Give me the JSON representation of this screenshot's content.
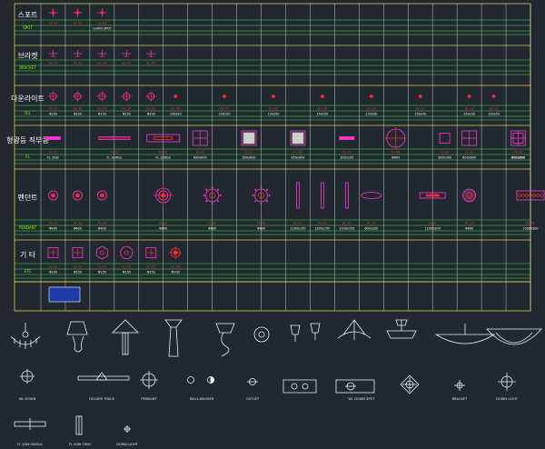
{
  "colors": {
    "background": "#212830",
    "frame": "#d8cc52",
    "grid_green": "#3ee84a",
    "grid_white": "#e8eef4",
    "magenta": "#ff36d0",
    "red": "#ff2b2b",
    "blue_fill": "#1c3aa8"
  },
  "legend_rows": [
    {
      "name": "spot",
      "category_label": "스포트",
      "code_label": "SPOT",
      "items": [
        {
          "icon": "crosshair-icon",
          "code": "SL-01",
          "desc": ""
        },
        {
          "icon": "crosshair-icon",
          "code": "SL-02",
          "desc": ""
        },
        {
          "icon": "crosshair-icon",
          "code": "SL-03",
          "desc": "CHAIN SPOT"
        }
      ]
    },
    {
      "name": "bracket",
      "category_label": "브라켓",
      "code_label": "BRACKET",
      "items": [
        {
          "icon": "bracket-icon",
          "code": "BL-01",
          "desc": ""
        },
        {
          "icon": "bracket-icon",
          "code": "BL-02",
          "desc": ""
        },
        {
          "icon": "bracket-icon",
          "code": "BL-03",
          "desc": ""
        },
        {
          "icon": "bracket-icon",
          "code": "BL-04",
          "desc": ""
        },
        {
          "icon": "bracket-icon",
          "code": "BL-05",
          "desc": ""
        }
      ]
    },
    {
      "name": "downlight",
      "category_label": "다운라이트",
      "code_label": "D/L",
      "items": [
        {
          "icon": "ring-cross-icon",
          "code": "DL-01",
          "desc": "Φ100"
        },
        {
          "icon": "ring-cross-icon",
          "code": "DL-02",
          "desc": "Φ150"
        },
        {
          "icon": "ring-cross-icon",
          "code": "DL-03",
          "desc": "Φ150"
        },
        {
          "icon": "ring-cross-icon",
          "code": "DL-04",
          "desc": "Φ150"
        },
        {
          "icon": "ring-cross-icon",
          "code": "DL-05",
          "desc": "Φ100"
        },
        {
          "icon": "dot-icon",
          "code": "DL-06",
          "desc": "150x50"
        },
        {
          "icon": "dot-icon",
          "code": "DL-07",
          "desc": "150x50"
        },
        {
          "icon": "dot-icon",
          "code": "DL-08",
          "desc": "150x50"
        },
        {
          "icon": "dot-icon",
          "code": "DL-09",
          "desc": "150x50"
        },
        {
          "icon": "dot-icon",
          "code": "DL-10",
          "desc": "150x50"
        },
        {
          "icon": "dot-icon",
          "code": "DL-11",
          "desc": "150x50"
        },
        {
          "icon": "dot-icon",
          "code": "DL-12",
          "desc": "150x50"
        },
        {
          "icon": "dot-icon",
          "code": "DL-13",
          "desc": "150x50"
        }
      ]
    },
    {
      "name": "fluorescent",
      "category_label": "형광등 직부등",
      "code_label": "FL",
      "items": [
        {
          "icon": "tube-icon",
          "code": "FL-01",
          "desc": "FL 32W"
        },
        {
          "icon": "tube-long-icon",
          "code": "FL-02",
          "desc": "FL 32Wx2"
        },
        {
          "icon": "tube-box-icon",
          "code": "FL-03",
          "desc": "FL 32Wx2"
        },
        {
          "icon": "square-grid-icon",
          "code": "FL-04",
          "desc": "600x600"
        },
        {
          "icon": "square-solid-icon",
          "code": "FL-05",
          "desc": "600x600"
        },
        {
          "icon": "square-solid-icon",
          "code": "FL-06",
          "desc": "450x450"
        },
        {
          "icon": "bar-icon",
          "code": "FL-07",
          "desc": "300x100"
        },
        {
          "icon": "circle-cross-icon",
          "code": "FL-08",
          "desc": "Φ600"
        },
        {
          "icon": "square-icon",
          "code": "FL-09",
          "desc": "300x300"
        },
        {
          "icon": "square-grid-icon",
          "code": "FL-10",
          "desc": "600x600"
        },
        {
          "icon": "square-icon",
          "code": "FL-11",
          "desc": "300x300"
        },
        {
          "icon": "square-grid-icon",
          "code": "FL-12",
          "desc": "600x600"
        }
      ]
    },
    {
      "name": "pendant",
      "category_label": "펜던트",
      "code_label": "PENDANT",
      "items": [
        {
          "icon": "pendant-ring-icon",
          "code": "PL-01",
          "desc": "Φ400"
        },
        {
          "icon": "pendant-ring-icon",
          "code": "PL-02",
          "desc": "Φ400"
        },
        {
          "icon": "pendant-ring-icon",
          "code": "PL-03",
          "desc": "Φ400"
        },
        {
          "icon": "pendant-large-icon",
          "code": "PL-04",
          "desc": "Φ800"
        },
        {
          "icon": "star-ring-icon",
          "code": "PL-05",
          "desc": "Φ800"
        },
        {
          "icon": "star-ring-icon",
          "code": "PL-06",
          "desc": "Φ800"
        },
        {
          "icon": "vertical-bar-icon",
          "code": "PL-07",
          "desc": "1200x150"
        },
        {
          "icon": "vertical-bar-icon",
          "code": "PL-08",
          "desc": "1200x150"
        },
        {
          "icon": "vertical-bar-icon",
          "code": "PL-09",
          "desc": "1200x150"
        },
        {
          "icon": "ellipse-icon",
          "code": "PL-10",
          "desc": "600x200"
        },
        {
          "icon": "long-box-icon",
          "code": "PL-11",
          "desc": "1200x300"
        },
        {
          "icon": "chandelier-ring-icon",
          "code": "PL-12",
          "desc": "Φ600"
        },
        {
          "icon": "pattern-box-icon",
          "code": "PL-13",
          "desc": "1500x300"
        }
      ]
    },
    {
      "name": "other",
      "category_label": "기 타",
      "code_label": "ETC",
      "items": [
        {
          "icon": "square-cross-icon",
          "code": "EL-01",
          "desc": "Φ100"
        },
        {
          "icon": "square-cross-icon",
          "code": "EL-02",
          "desc": "Φ150"
        },
        {
          "icon": "hexagon-icon",
          "code": "EL-03",
          "desc": "Φ150"
        },
        {
          "icon": "octagon-icon",
          "code": "EL-04",
          "desc": "Φ150"
        },
        {
          "icon": "square-cross-icon",
          "code": "EL-05",
          "desc": "Φ150"
        },
        {
          "icon": "target-icon",
          "code": "EL-06",
          "desc": "Φ100"
        }
      ]
    }
  ],
  "bottom_captions": {
    "row1": [
      "WL DOWN",
      "HOLDER TRACK",
      "PENDANT",
      "WALL-WASHER",
      "OUTLET",
      "",
      "WL DOWN SPOT",
      "BRACKET",
      "DOWN LIGHT"
    ],
    "row2": [
      "FL 40W SINGLE",
      "FL 40W TWIN",
      "DOWN LIGHT"
    ]
  }
}
